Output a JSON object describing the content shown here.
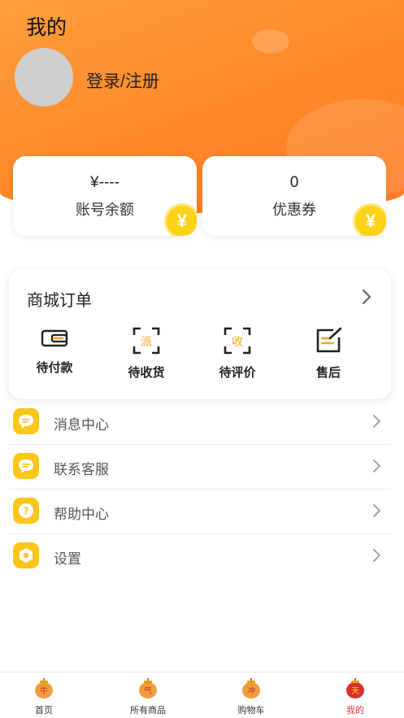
{
  "header": {
    "title": "我的",
    "login_label": "登录/注册"
  },
  "wallet": [
    {
      "value": "¥----",
      "label": "账号余额",
      "coin": "¥"
    },
    {
      "value": "0",
      "label": "优惠券",
      "coin": "¥"
    }
  ],
  "orders": {
    "title": "商城订单",
    "items": [
      {
        "label": "待付款",
        "icon": "wallet-icon"
      },
      {
        "label": "待收货",
        "icon": "delivery-scan-icon",
        "glyph": "派"
      },
      {
        "label": "待评价",
        "icon": "review-scan-icon",
        "glyph": "收"
      },
      {
        "label": "售后",
        "icon": "after-sales-icon"
      }
    ]
  },
  "menu": [
    {
      "label": "消息中心",
      "icon": "message-icon"
    },
    {
      "label": "联系客服",
      "icon": "customer-service-icon"
    },
    {
      "label": "帮助中心",
      "icon": "help-icon",
      "glyph": "?"
    },
    {
      "label": "设置",
      "icon": "settings-icon"
    }
  ],
  "tabbar": [
    {
      "label": "首页",
      "glyph": "牛",
      "active": false
    },
    {
      "label": "所有商品",
      "glyph": "气",
      "active": false
    },
    {
      "label": "购物车",
      "glyph": "冲",
      "active": false
    },
    {
      "label": "我的",
      "glyph": "天",
      "active": true
    }
  ],
  "colors": {
    "accent": "#ff8a2b",
    "coin": "#ffd21a",
    "menu_icon": "#ffc61a",
    "tab_active": "#e5373a"
  }
}
